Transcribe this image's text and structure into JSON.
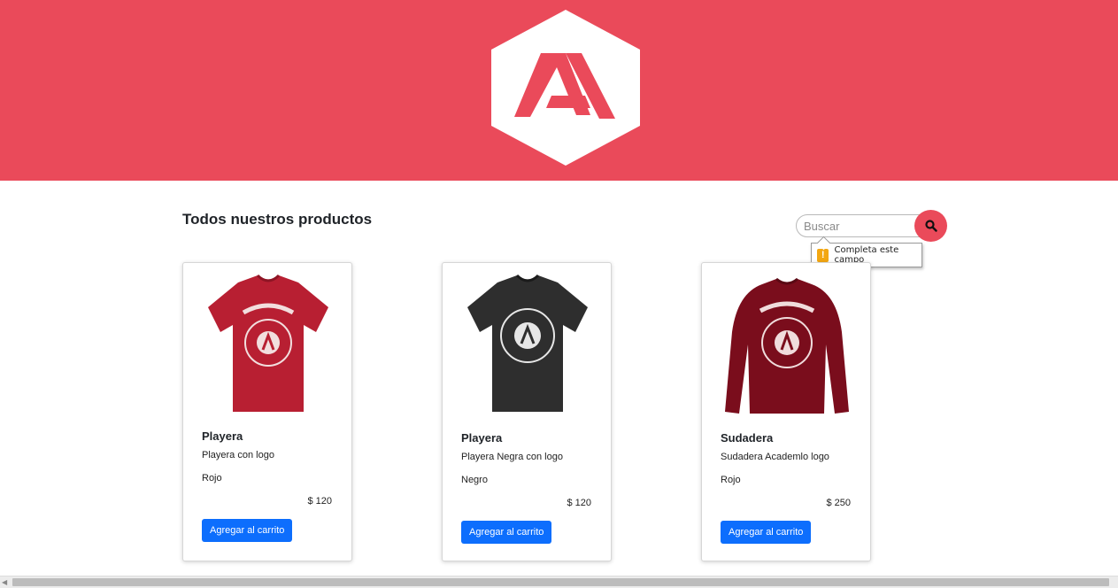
{
  "header": {
    "brand_color": "#ea4a5a",
    "logo_icon": "academlo-logo"
  },
  "main": {
    "title": "Todos nuestros productos"
  },
  "search": {
    "placeholder": "Buscar",
    "value": "",
    "icon": "search-icon",
    "validation_tooltip": "Completa este campo"
  },
  "products": [
    {
      "name": "Playera",
      "description": "Playera con logo",
      "color": "Rojo",
      "price": "$ 120",
      "button_label": "Agregar al carrito",
      "image": "red-tshirt"
    },
    {
      "name": "Playera",
      "description": "Playera Negra con logo",
      "color": "Negro",
      "price": "$ 120",
      "button_label": "Agregar al carrito",
      "image": "black-tshirt"
    },
    {
      "name": "Sudadera",
      "description": "Sudadera Academlo logo",
      "color": "Rojo",
      "price": "$ 250",
      "button_label": "Agregar al carrito",
      "image": "maroon-sweatshirt"
    }
  ],
  "colors": {
    "accent": "#ea4a5a",
    "button": "#0d6efd",
    "warning": "#f3a712"
  }
}
